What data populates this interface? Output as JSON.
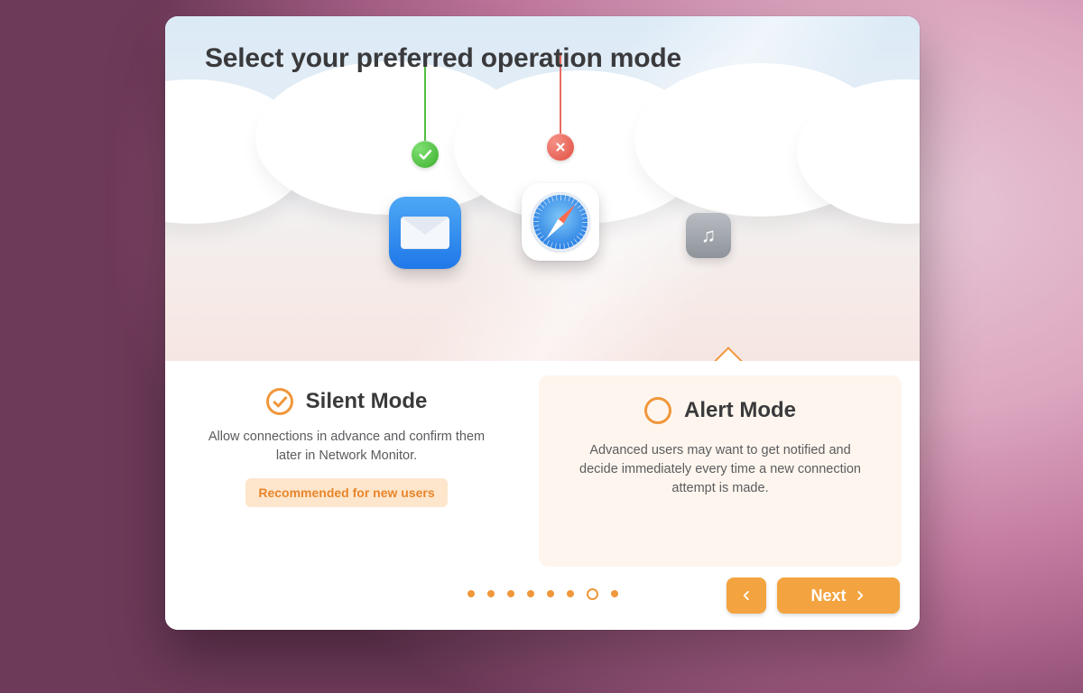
{
  "title": "Select your preferred operation mode",
  "illustration": {
    "apps": [
      {
        "name": "mail",
        "status": "allowed"
      },
      {
        "name": "safari",
        "status": "blocked"
      },
      {
        "name": "music",
        "status": "none"
      }
    ]
  },
  "options": {
    "silent": {
      "title": "Silent Mode",
      "description": "Allow connections in advance and confirm them later in Network Monitor.",
      "recommended_label": "Recommended for new users",
      "selected": true
    },
    "alert": {
      "title": "Alert Mode",
      "description": "Advanced users may want to get notified and decide immediately every time a new connection attempt is made.",
      "selected": false
    }
  },
  "pager": {
    "total": 8,
    "current_index": 6
  },
  "nav": {
    "next_label": "Next"
  },
  "colors": {
    "accent": "#f0973b",
    "allow": "#49b53c",
    "block": "#e24f42"
  }
}
